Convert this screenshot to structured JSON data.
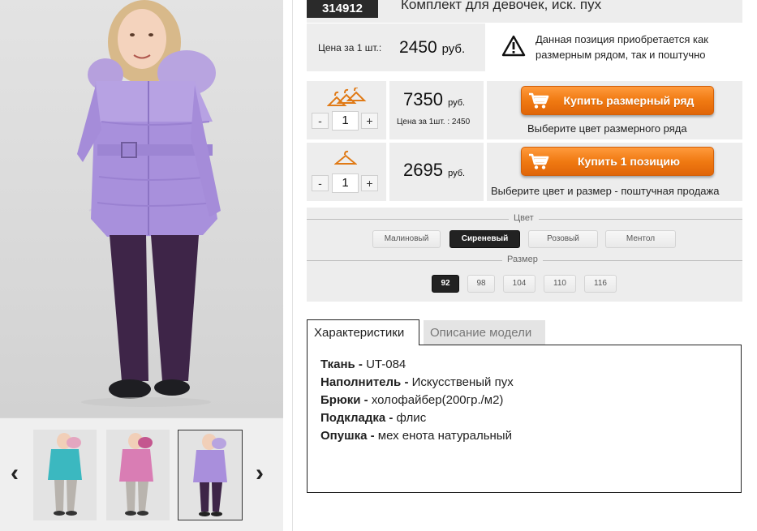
{
  "product": {
    "sku": "314912",
    "title": "Комплект для девочек, иск. пух",
    "unit_price_label": "Цена за 1 шт.:",
    "unit_price_value": "2450",
    "unit_price_currency": "руб.",
    "notice": "Данная позиция приобретается как размерным рядом, так и поштучно"
  },
  "gallery": {
    "prev_icon": "chevron-left-icon",
    "next_icon": "chevron-right-icon",
    "thumbs": [
      {
        "color": "teal",
        "jacket": "#3bb8c0",
        "pants": "#b8b3ad"
      },
      {
        "color": "pink",
        "jacket": "#d97db4",
        "pants": "#b9b4ae"
      },
      {
        "color": "lilac",
        "jacket": "#a98fdc",
        "pants": "#3e2548",
        "selected": true
      }
    ]
  },
  "size_row": {
    "qty_minus": "-",
    "qty_value": "1",
    "qty_plus": "+",
    "price": "7350",
    "currency": "руб.",
    "per_unit_note": "Цена за 1шт. : 2450",
    "buy_label": "Купить размерный ряд",
    "hint": "Выберите цвет размерного ряда"
  },
  "single_row": {
    "qty_minus": "-",
    "qty_value": "1",
    "qty_plus": "+",
    "price": "2695",
    "currency": "руб.",
    "buy_label": "Купить 1 позицию",
    "hint": "Выберите цвет и размер - поштучная продажа"
  },
  "options": {
    "color_heading": "Цвет",
    "colors": [
      "Малиновый",
      "Сиреневый",
      "Розовый",
      "Ментол"
    ],
    "selected_color": "Сиреневый",
    "size_heading": "Размер",
    "sizes": [
      "92",
      "98",
      "104",
      "110",
      "116"
    ],
    "selected_size": "92"
  },
  "tabs": {
    "characteristics": "Характеристики",
    "description": "Описание модели"
  },
  "specs": [
    {
      "name": "Ткань -",
      "value": "UT-084"
    },
    {
      "name": "Наполнитель -",
      "value": "Искусственый пух"
    },
    {
      "name": "Брюки -",
      "value": "холофайбер(200гр./м2)"
    },
    {
      "name": "Подкладка -",
      "value": "флис"
    },
    {
      "name": "Опушка -",
      "value": "мех енота натуральный"
    }
  ],
  "colors": {
    "accent_orange": "#f07a12",
    "panel_bg": "#ededed",
    "sku_bg": "#2a2a2a"
  }
}
